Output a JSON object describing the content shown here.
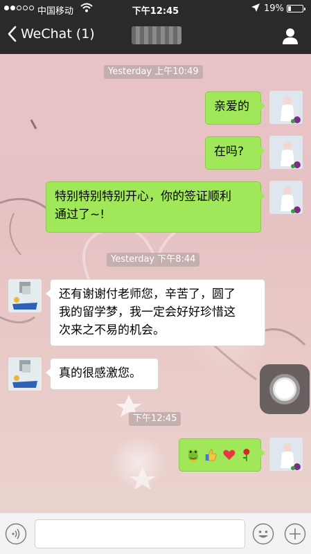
{
  "status_bar": {
    "carrier": "中国移动",
    "time": "下午12:45",
    "battery_text": "19%",
    "battery_level": 0.19,
    "signal_bars_filled": 2,
    "signal_bars_total": 5
  },
  "nav": {
    "back_label": "WeChat (1)",
    "contact_name": ""
  },
  "chat": {
    "timestamps": [
      "Yesterday 上午10:49",
      "Yesterday 下午8:44",
      "下午12:45"
    ],
    "messages": [
      {
        "side": "right",
        "text": "亲爱的"
      },
      {
        "side": "right",
        "text": "在吗?"
      },
      {
        "side": "right",
        "lines": [
          "特别特别特别开心，你的签证顺利",
          "通过了~!"
        ]
      },
      {
        "side": "left",
        "lines": [
          "还有谢谢付老师您，辛苦了，圆了",
          "我的留学梦，我一定会好好珍惜这",
          "次来之不易的机会。"
        ]
      },
      {
        "side": "left",
        "text": "真的很感激您。"
      },
      {
        "side": "right",
        "emoji": [
          "frog-face",
          "thumbs-up",
          "red-heart",
          "rose"
        ]
      }
    ]
  },
  "input": {
    "value": "",
    "placeholder": ""
  },
  "colors": {
    "nav_bg": "#2a2a2a",
    "sent_bubble": "#a0e75a",
    "received_bubble": "#ffffff",
    "input_bar_bg": "#f3f3f5"
  }
}
